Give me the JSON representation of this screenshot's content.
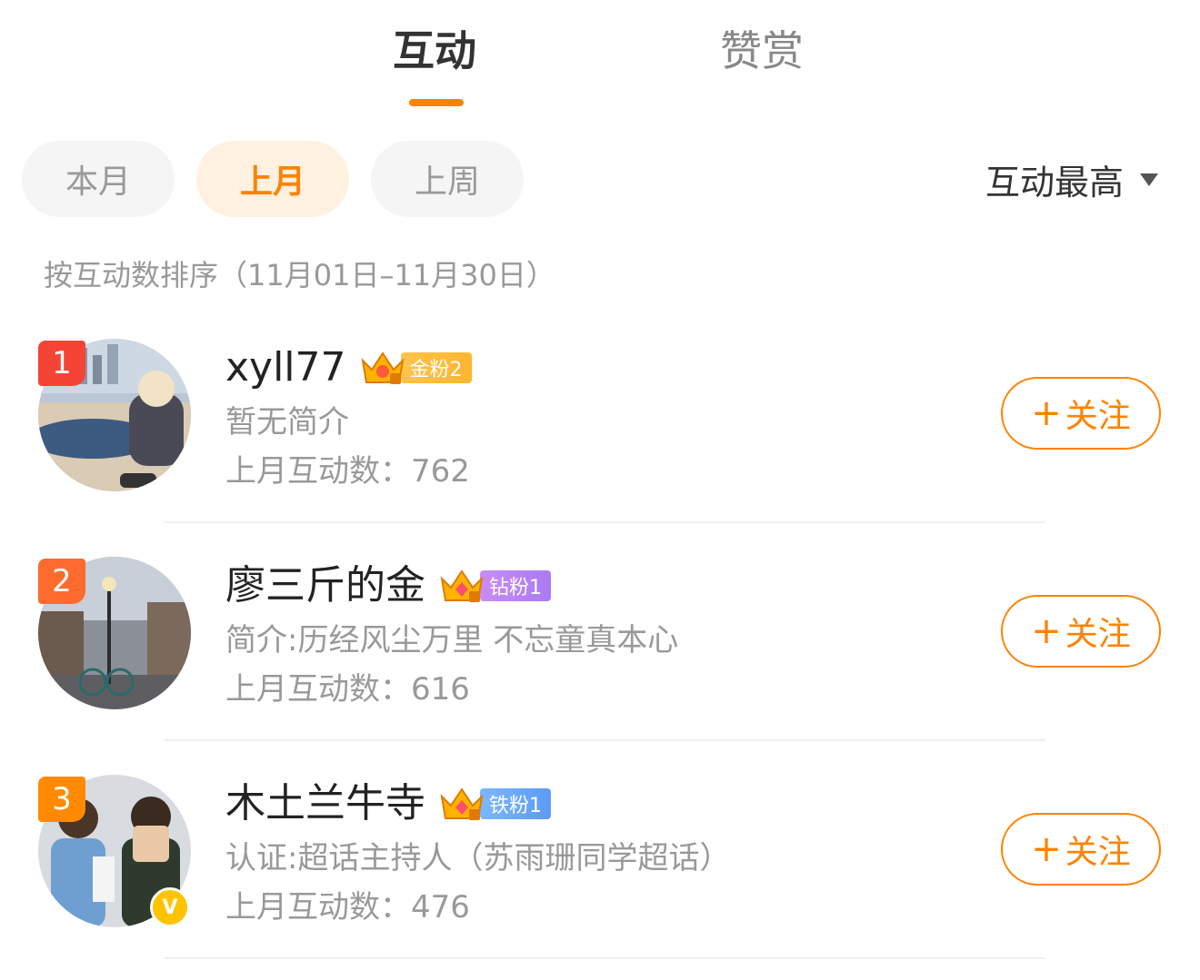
{
  "tabs": [
    {
      "label": "互动",
      "active": true
    },
    {
      "label": "赞赏",
      "active": false
    }
  ],
  "filters": [
    {
      "label": "本月",
      "selected": false
    },
    {
      "label": "上月",
      "selected": true
    },
    {
      "label": "上周",
      "selected": false
    }
  ],
  "sort": {
    "label": "互动最高",
    "icon": "caret-down-icon"
  },
  "sort_description": "按互动数排序（11月01日–11月30日）",
  "follow_label": "关注",
  "follow_plus": "+",
  "users": [
    {
      "rank": "1",
      "name": "xyll77",
      "fan_badge": "金粉2",
      "bio": "暂无简介",
      "count": "上月互动数：762",
      "verified": false
    },
    {
      "rank": "2",
      "name": "廖三斤的金",
      "fan_badge": "钻粉1",
      "bio": "简介:历经风尘万里 不忘童真本心",
      "count": "上月互动数：616",
      "verified": false
    },
    {
      "rank": "3",
      "name": "木土兰牛寺",
      "fan_badge": "铁粉1",
      "bio": "认证:超话主持人（苏雨珊同学超话）",
      "count": "上月互动数：476",
      "verified": true
    }
  ],
  "colors": {
    "accent": "#ff8200",
    "rank1": "#f54336",
    "rank2": "#ff6b2c",
    "rank3": "#ff8a00"
  }
}
